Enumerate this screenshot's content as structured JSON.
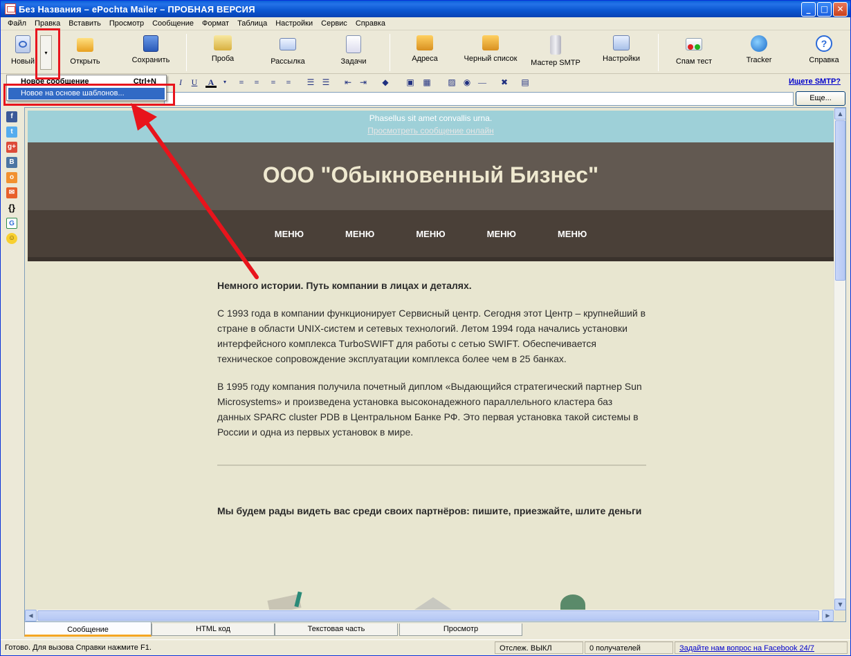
{
  "window": {
    "title": "Без Названия – ePochta Mailer – ПРОБНАЯ ВЕРСИЯ",
    "min": "_",
    "max": "□",
    "close": "✕"
  },
  "menu": [
    "Файл",
    "Правка",
    "Вставить",
    "Просмотр",
    "Сообщение",
    "Формат",
    "Таблица",
    "Настройки",
    "Сервис",
    "Справка"
  ],
  "toolbar": {
    "new": "Новый",
    "open": "Открыть",
    "save": "Сохранить",
    "test": "Проба",
    "send": "Рассылка",
    "tasks": "Задачи",
    "addresses": "Адреса",
    "blacklist": "Черный список",
    "smtp_wizard": "Мастер SMTP",
    "settings": "Настройки",
    "spam_test": "Спам тест",
    "tracker": "Tracker",
    "help": "Справка"
  },
  "fmtbar": {
    "smtp_link": "Ищете SMTP?"
  },
  "field": {
    "more": "Еще..."
  },
  "dropdown": {
    "new_message": "Новое сообщение",
    "new_message_shortcut": "Ctrl+N",
    "new_from_template": "Новое на основе шаблонов..."
  },
  "email": {
    "preheader": "Phasellus sit amet convallis urna.",
    "view_online": "Просмотреть сообщение онлайн",
    "company": "ООО \"Обыкновенный Бизнес\"",
    "nav": [
      "МЕНЮ",
      "МЕНЮ",
      "МЕНЮ",
      "МЕНЮ",
      "МЕНЮ"
    ],
    "heading": "Немного истории. Путь компании в лицах и деталях.",
    "para1": "С 1993 года в компании функционирует Сервисный центр. Сегодня этот Центр – крупнейший в стране в области UNIX-систем и сетевых технологий. Летом 1994 года начались установки интерфейсного комплекса TurboSWIFT для работы с сетью SWIFT. Обеспечивается техническое сопровождение эксплуатации комплекса более чем в 25 банках.",
    "para2": "В 1995 году компания получила почетный диплом «Выдающийся стратегический партнер Sun Microsystems» и произведена установка высоконадежного параллельного кластера баз данных SPARC cluster PDB в Центральном Банке РФ. Это первая установка такой системы в России и одна из первых установок в мире.",
    "closing": "Мы будем рады видеть вас среди своих партнёров: пишите, приезжайте, шлите деньги"
  },
  "tabs": [
    "Сообщение",
    "HTML код",
    "Текстовая часть",
    "Просмотр"
  ],
  "status": {
    "ready": "Готово. Для вызова Справки нажмите F1.",
    "tracking": "Отслеж. ВЫКЛ",
    "recipients": "0 получателей",
    "facebook": "Задайте нам вопрос на Facebook 24/7"
  },
  "colors": {
    "highlight": "#e8141c",
    "menu_selected": "#316ac5",
    "preheader": "#9ed0d8",
    "hero": "#625951",
    "nav": "#4a4038"
  }
}
